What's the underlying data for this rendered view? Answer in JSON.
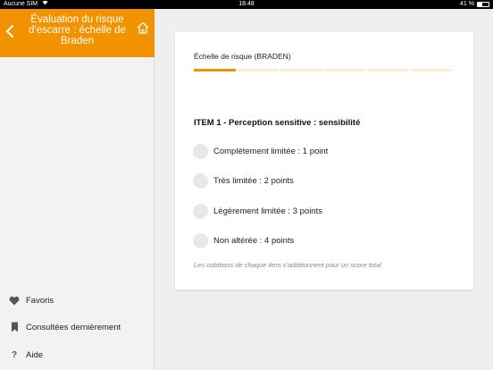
{
  "status_bar": {
    "carrier": "Aucune SIM",
    "time": "18:48",
    "battery": "41 %",
    "battery_level": 0.41,
    "wifi_icon": "wifi-icon"
  },
  "sidebar": {
    "header": {
      "title": "Évaluation du risque d'escarre : échelle de Braden",
      "back_icon": "chevron-left-icon",
      "home_icon": "home-icon",
      "background_color": "#f39200"
    },
    "menu": [
      {
        "label": "Favoris",
        "icon": "heart-icon"
      },
      {
        "label": "Consultées dernièrement",
        "icon": "bookmark-icon"
      },
      {
        "label": "Aide",
        "icon": "question-icon"
      }
    ]
  },
  "card": {
    "title": "Échelle de risque (BRADEN)",
    "progress": {
      "current_step": 1,
      "total_steps": 6,
      "accent_color": "#f39200"
    },
    "item_title": "ITEM 1 - Perception sensitive : sensibilité",
    "options": [
      {
        "label": "Complètement limitée : 1 point",
        "selected": false
      },
      {
        "label": "Très limitée : 2 points",
        "selected": false
      },
      {
        "label": "Légèrement limitée : 3 points",
        "selected": false
      },
      {
        "label": "Non altérée : 4 points",
        "selected": false
      }
    ],
    "footnote": "Les cotations de chaque item s'additionnent pour un score total"
  }
}
